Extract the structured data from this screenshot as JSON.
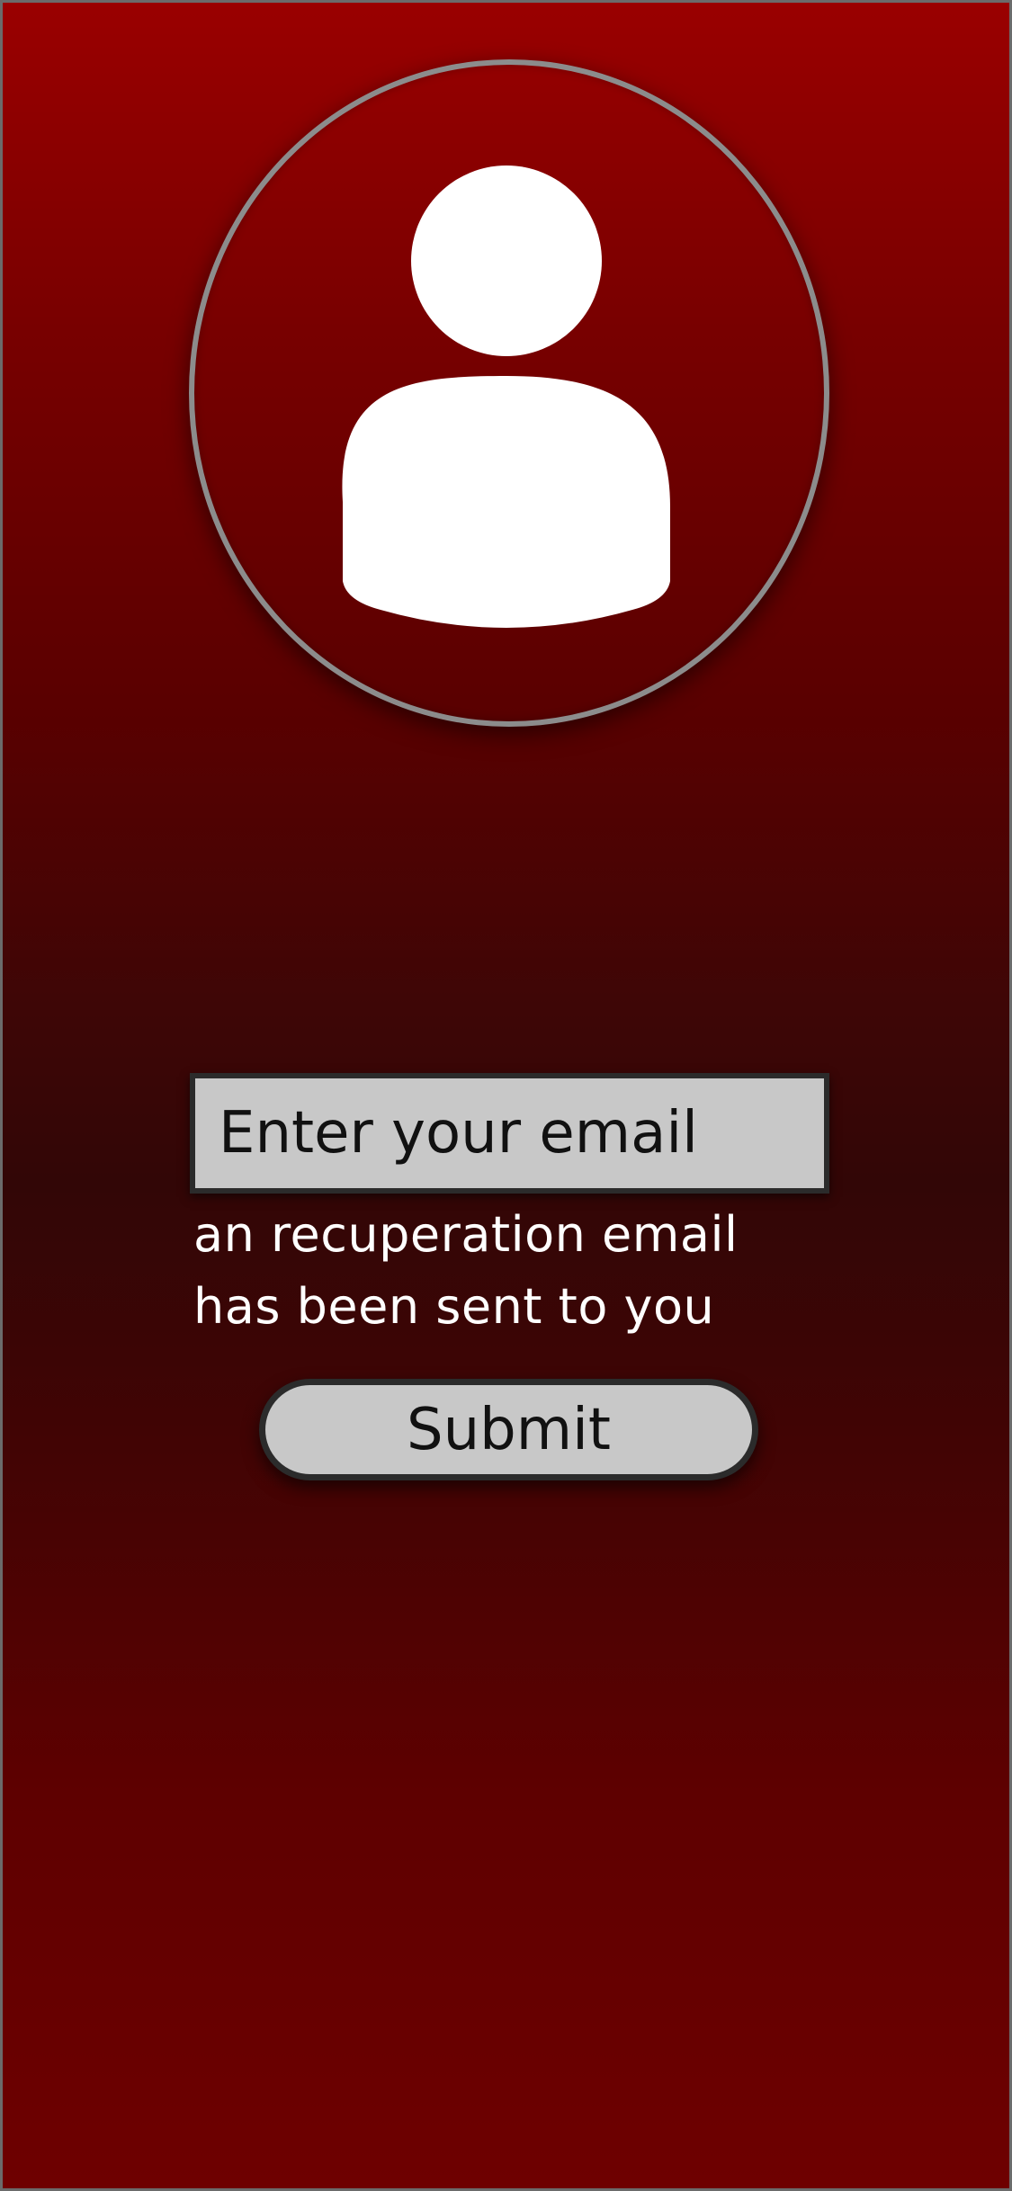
{
  "colors": {
    "background_top": "#9a0000",
    "background_middle": "#320606",
    "background_bottom": "#6e0000",
    "ring": "#8c8c8c",
    "avatar_fill": "#ffffff",
    "field_fill": "#c8c8c8",
    "field_border": "#2b2b2b",
    "text_light": "#ffffff",
    "text_dark": "#111111"
  },
  "avatar": {
    "icon": "user-icon"
  },
  "email": {
    "placeholder": "Enter your email",
    "value": ""
  },
  "status": {
    "message": "an recuperation email has been sent to you"
  },
  "actions": {
    "submit_label": "Submit"
  }
}
